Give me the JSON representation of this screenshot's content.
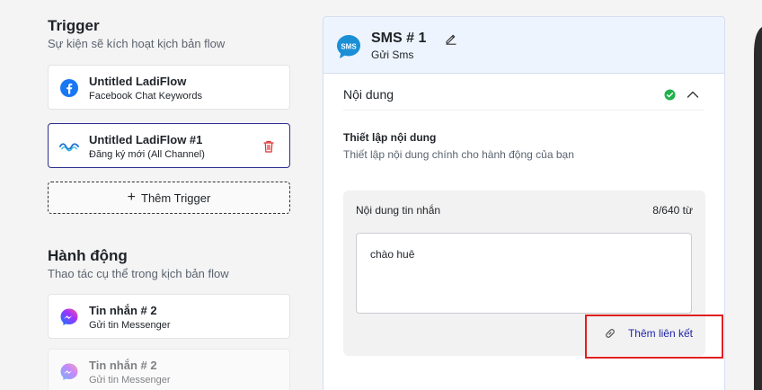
{
  "trigger": {
    "title": "Trigger",
    "subtitle": "Sự kiện sẽ kích hoạt kịch bản flow",
    "items": [
      {
        "name": "Untitled LadiFlow",
        "desc": "Facebook Chat Keywords",
        "icon": "facebook-icon"
      },
      {
        "name": "Untitled LadiFlow #1",
        "desc": "Đăng ký mới (All Channel)",
        "icon": "ladiflow-icon"
      }
    ],
    "add_label": "Thêm Trigger"
  },
  "actions": {
    "title": "Hành động",
    "subtitle": "Thao tác cụ thể trong kịch bản flow",
    "items": [
      {
        "name": "Tin nhắn # 2",
        "desc": "Gửi tin Messenger",
        "icon": "messenger-icon"
      },
      {
        "name": "Tin nhắn # 2",
        "desc": "Gửi tin Messenger",
        "icon": "messenger-icon"
      }
    ]
  },
  "panel": {
    "icon_text": "SMS",
    "title": "SMS # 1",
    "subtitle": "Gửi Sms",
    "section_title": "Nội dung",
    "setup_title": "Thiết lập nội dung",
    "setup_subtitle": "Thiết lập nội dung chính cho hành động của bạn",
    "message_label": "Nội dung tin nhắn",
    "word_count": "8/640 từ",
    "message_value": "chào huê",
    "add_link_label": "Thêm liên kết"
  },
  "colors": {
    "accent": "#1f24a8",
    "header_bg": "#eef4fd",
    "highlight": "#e02020",
    "success": "#22b14c",
    "sms_blue": "#1a8fd6"
  }
}
